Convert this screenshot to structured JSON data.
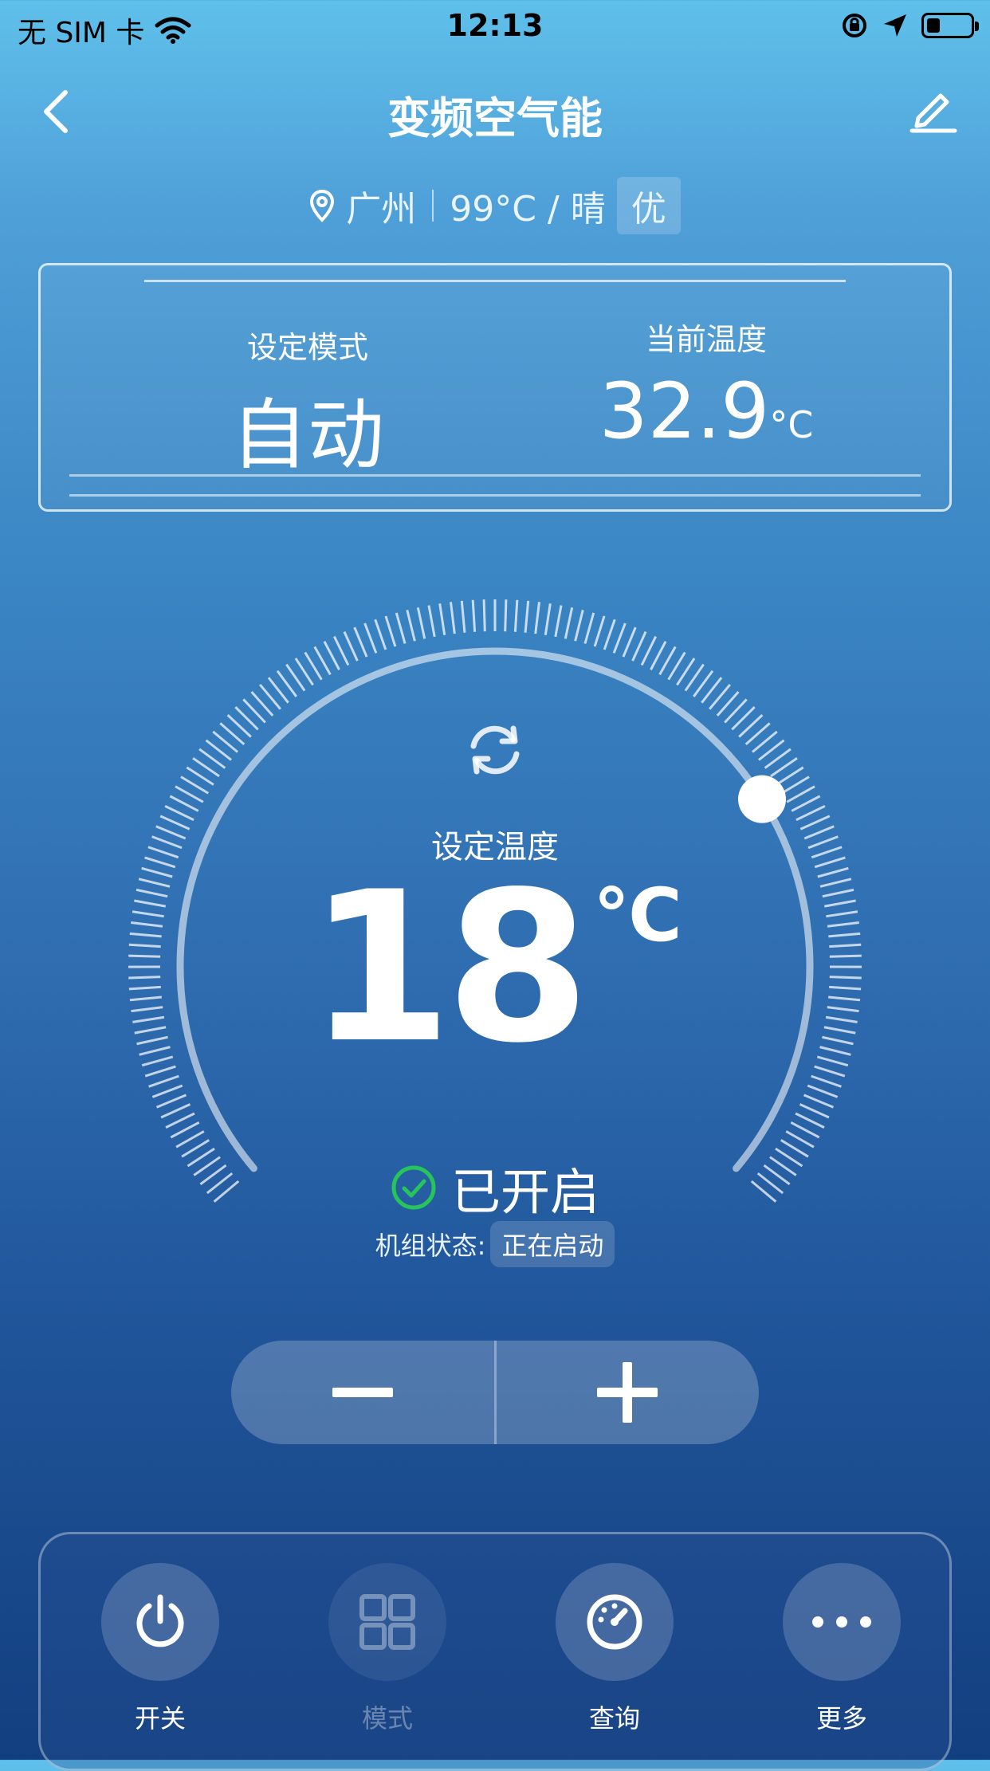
{
  "status_bar": {
    "carrier": "无 SIM 卡",
    "time": "12:13",
    "battery_level": 0.3
  },
  "nav": {
    "title": "变频空气能",
    "back_icon": "chevron-left-icon",
    "edit_icon": "pencil-icon"
  },
  "location": {
    "city": "广州",
    "weather": "99°C / 晴",
    "air_quality": "优"
  },
  "info_card": {
    "mode_label": "设定模式",
    "mode_value": "自动",
    "temp_label": "当前温度",
    "temp_value": "32.9",
    "temp_unit": "°C"
  },
  "gauge": {
    "label": "设定温度",
    "value": "18",
    "unit": "℃",
    "status": "已开启",
    "unit_state_label": "机组状态:",
    "unit_state_value": "正在启动",
    "colors": {
      "status_ok": "#26c45a"
    }
  },
  "stepper": {
    "minus_icon": "minus-icon",
    "plus_icon": "plus-icon"
  },
  "bottom_tabs": [
    {
      "label": "开关",
      "icon": "power-icon",
      "enabled": true
    },
    {
      "label": "模式",
      "icon": "grid-icon",
      "enabled": false
    },
    {
      "label": "查询",
      "icon": "speedometer-icon",
      "enabled": true
    },
    {
      "label": "更多",
      "icon": "more-dots-icon",
      "enabled": true
    }
  ]
}
